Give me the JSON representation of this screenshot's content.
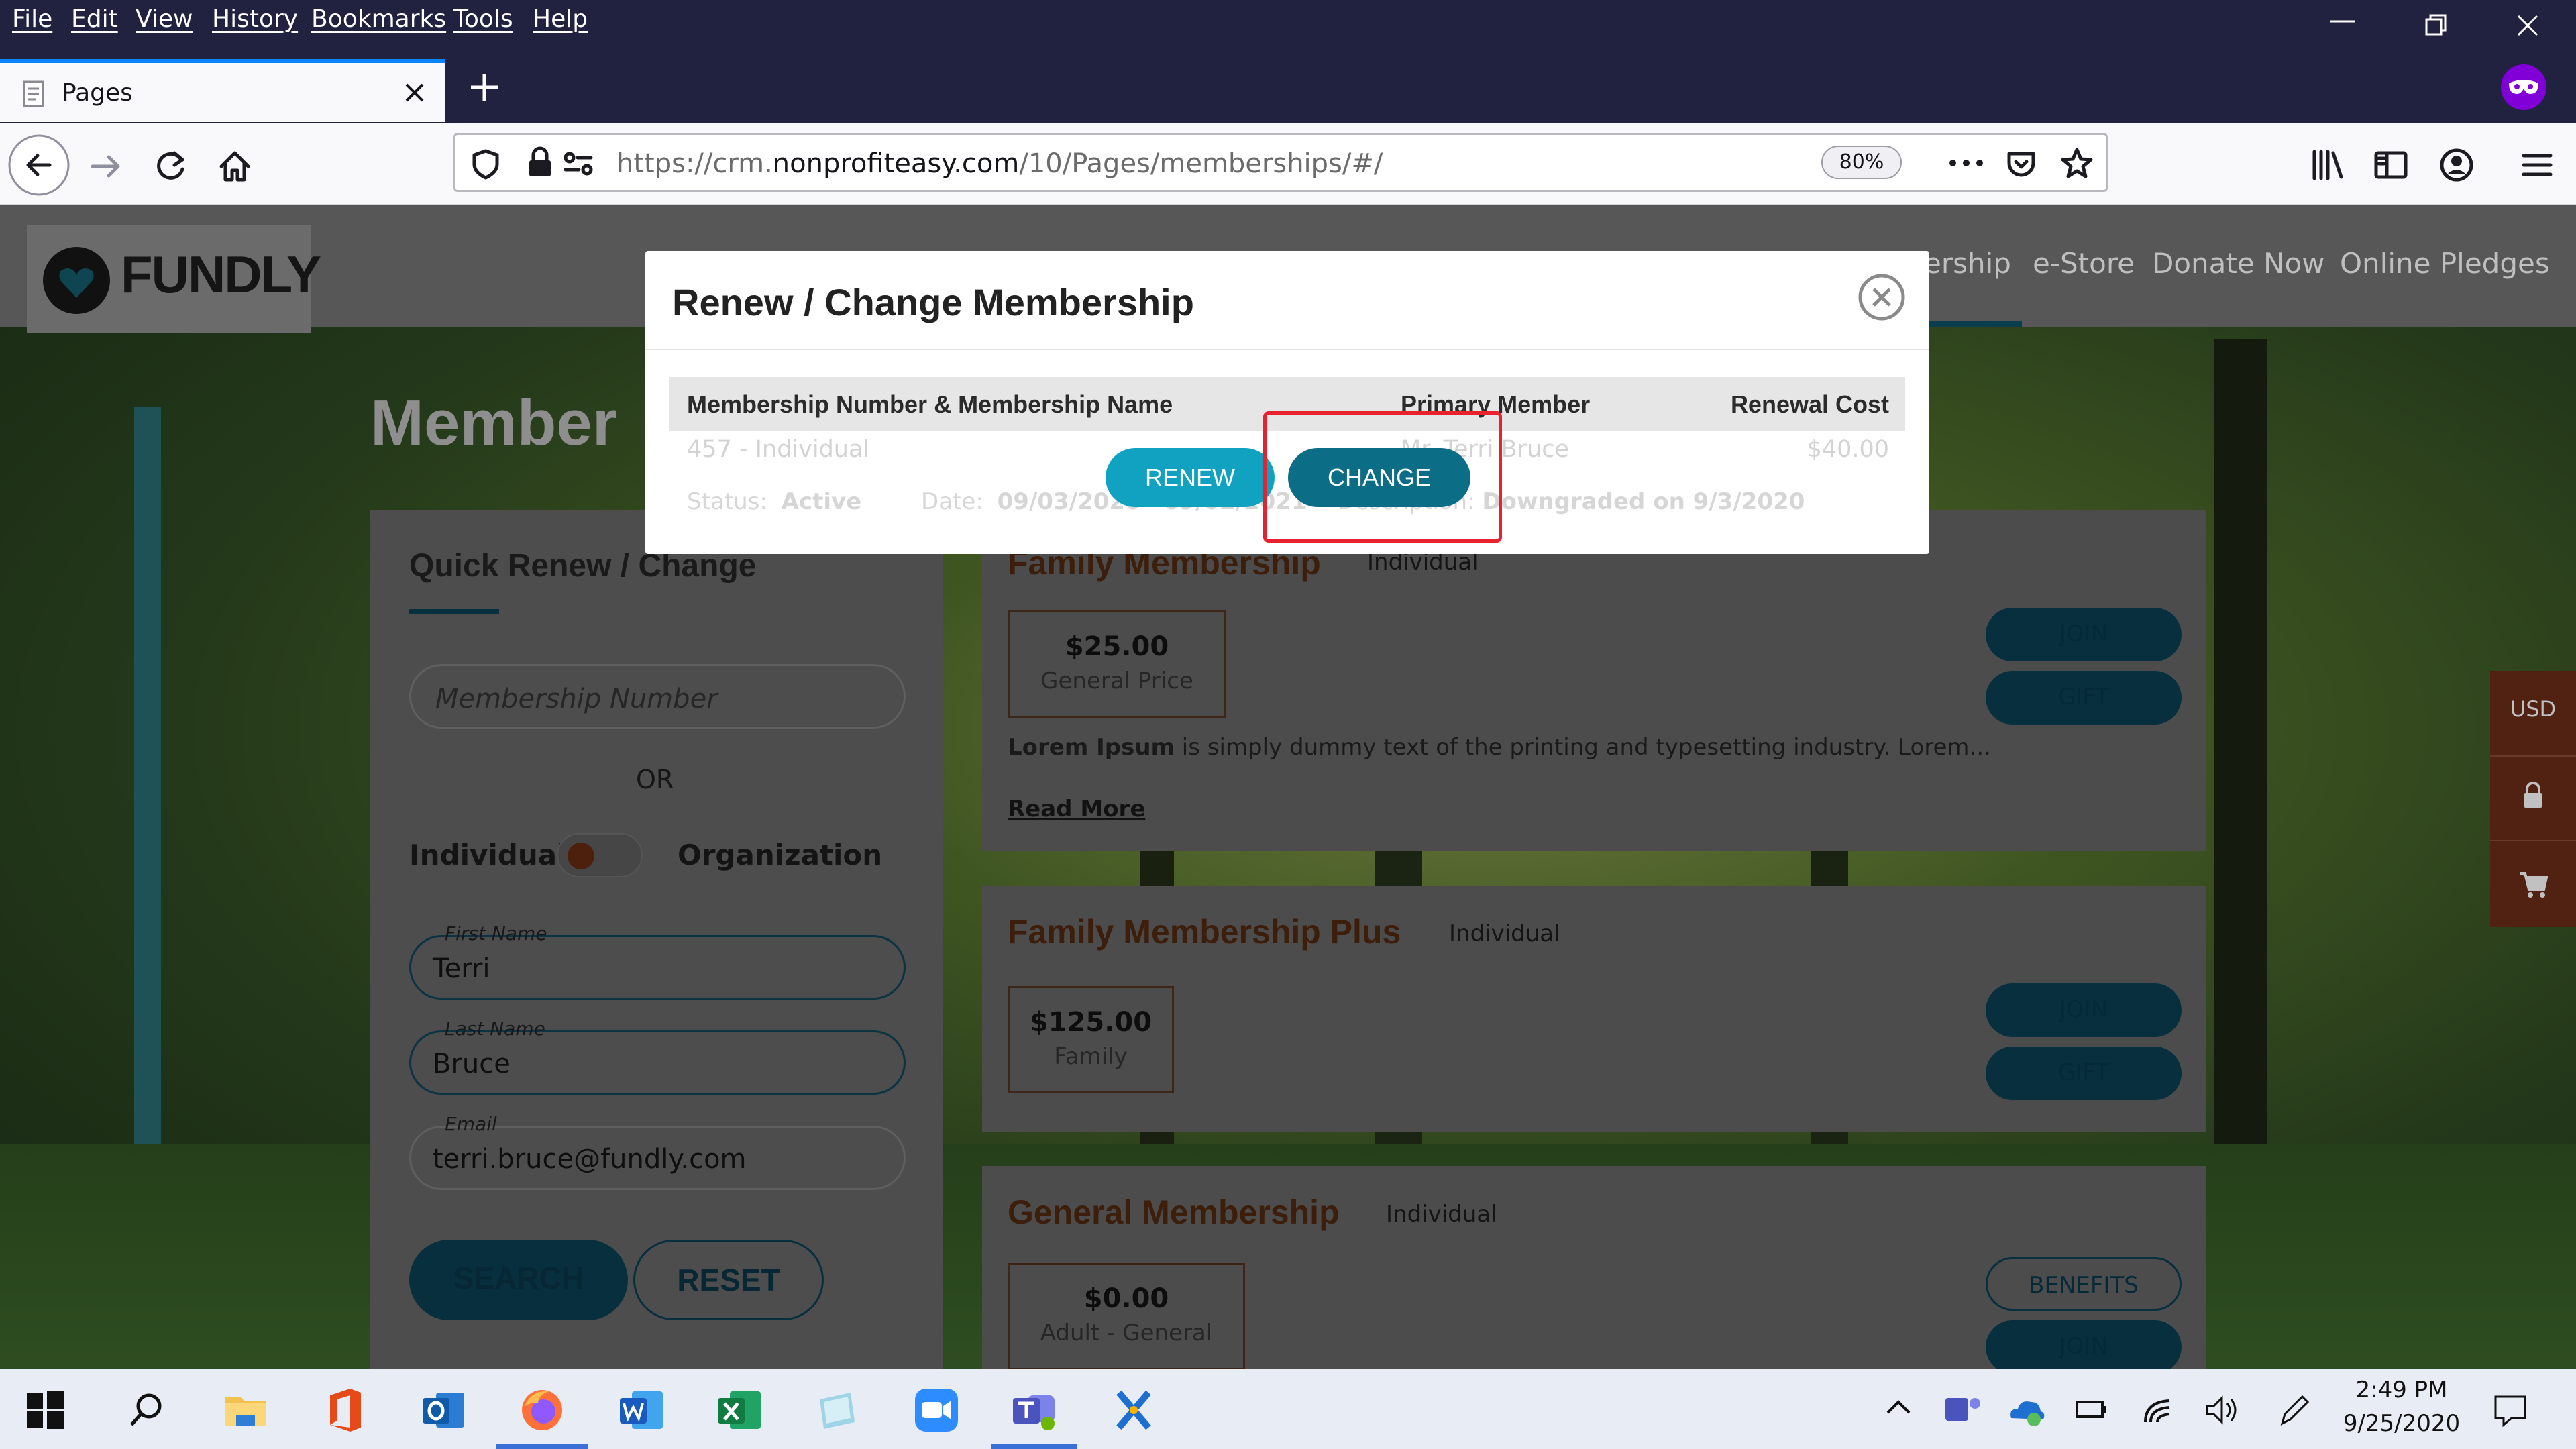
{
  "menubar": {
    "items": [
      "File",
      "Edit",
      "View",
      "History",
      "Bookmarks",
      "Tools",
      "Help"
    ]
  },
  "tab": {
    "title": "Pages"
  },
  "toolbar": {
    "url_prefix": "https://crm.",
    "url_host": "nonprofiteasy.com",
    "url_path": "/10/Pages/memberships/#/",
    "zoom": "80%"
  },
  "site": {
    "logo": "FUNDLY",
    "nav": [
      "ership",
      "e-Store",
      "Donate Now",
      "Online Pledges"
    ],
    "heading": "Member",
    "sidebar": {
      "title": "Quick Renew / Change",
      "membership_placeholder": "Membership Number",
      "or": "OR",
      "toggle_left": "Individual",
      "toggle_right": "Organization",
      "first_name_label": "First Name",
      "first_name": "Terri",
      "last_name_label": "Last Name",
      "last_name": "Bruce",
      "email_label": "Email",
      "email": "terri.bruce@fundly.com",
      "search": "SEARCH",
      "reset": "RESET"
    },
    "cards": [
      {
        "title": "Family Membership",
        "type": "Individual",
        "price": "$25.00",
        "price_label": "General Price",
        "desc_bold": "Lorem Ipsum",
        "desc": " is simply dummy text of the printing and typesetting industry. Lorem...",
        "read_more": "Read More",
        "buttons": [
          "JOIN",
          "GIFT"
        ]
      },
      {
        "title": "Family Membership Plus",
        "type": "Individual",
        "price": "$125.00",
        "price_label": "Family",
        "buttons": [
          "JOIN",
          "GIFT"
        ]
      },
      {
        "title": "General Membership",
        "type": "Individual",
        "price": "$0.00",
        "price_label": "Adult - General",
        "buttons": [
          "BENEFITS",
          "JOIN"
        ]
      }
    ],
    "right_tab": {
      "currency": "USD"
    }
  },
  "modal": {
    "title": "Renew / Change Membership",
    "columns": [
      "Membership Number & Membership Name",
      "Primary Member",
      "Renewal Cost"
    ],
    "row": {
      "membership": "457 - Individual",
      "member": "Mr. Terri Bruce",
      "cost": "$40.00",
      "status_label": "Status:",
      "status": "Active",
      "date_label": "Date:",
      "date_start": "09/03/2020",
      "date_end": "09/02/2021",
      "desc_label": "Description:",
      "desc": "Downgraded on 9/3/2020"
    },
    "renew_button": "RENEW",
    "change_button": "CHANGE"
  },
  "taskbar": {
    "time": "2:49 PM",
    "date": "9/25/2020"
  },
  "colors": {
    "browser_chrome": "#202240",
    "renew_button": "#12a2c1",
    "change_button": "#0b6d86",
    "highlight": "#e8212f",
    "card_title": "#3c1e0b"
  }
}
